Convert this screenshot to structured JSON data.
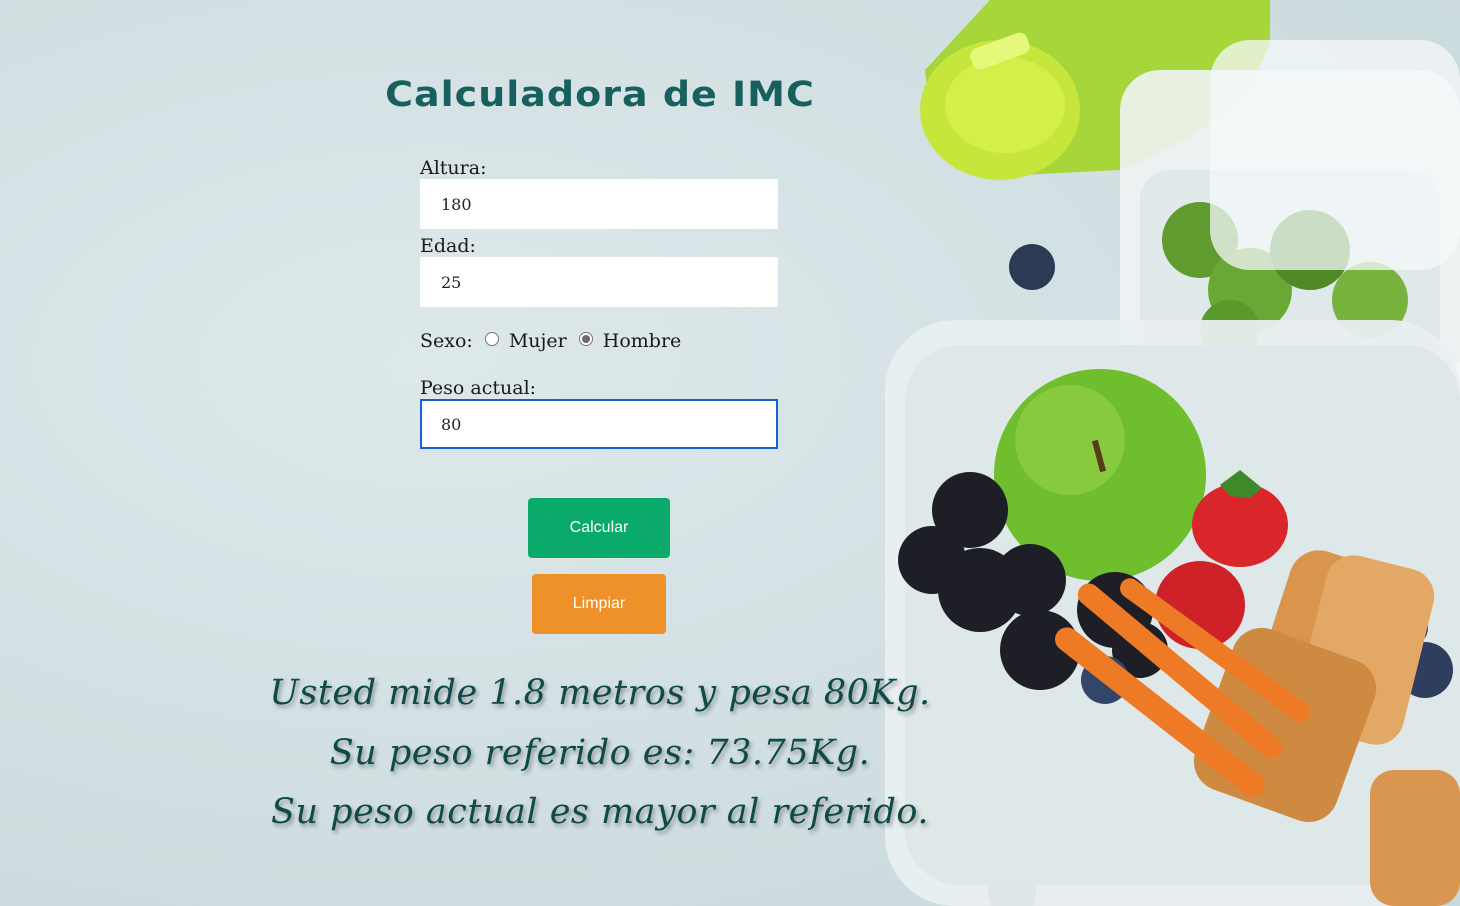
{
  "title": "Calculadora de IMC",
  "form": {
    "altura_label": "Altura:",
    "altura_value": "180",
    "edad_label": "Edad:",
    "edad_value": "25",
    "sexo_label": "Sexo:",
    "sexo_options": [
      "Mujer",
      "Hombre"
    ],
    "sexo_selected": "Hombre",
    "peso_label": "Peso actual:",
    "peso_value": "80"
  },
  "buttons": {
    "calcular": "Calcular",
    "limpiar": "Limpiar"
  },
  "result": {
    "line1": "Usted mide 1.8 metros y pesa 80Kg.",
    "line2": "Su peso referido es: 73.75Kg.",
    "line3": "Su peso actual es mayor al referido."
  },
  "colors": {
    "title": "#18605e",
    "calcular_button": "#0aaa6b",
    "limpiar_button": "#ee9128",
    "result_text": "#0f4a48",
    "focus_border": "#1a5fd0"
  }
}
